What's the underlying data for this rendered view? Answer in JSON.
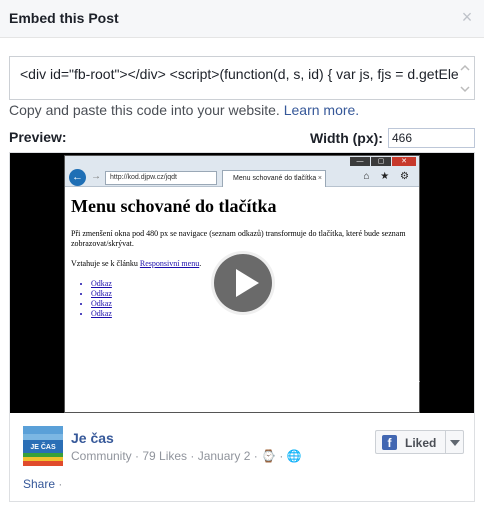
{
  "dialog": {
    "title": "Embed this Post",
    "close_glyph": "×"
  },
  "embed_code": {
    "value": "<div id=\"fb-root\"></div> <script>(function(d, s, id) { var js, fjs = d.getEle"
  },
  "help": {
    "text": "Copy and paste this code into your website.",
    "link": "Learn more."
  },
  "preview": {
    "label": "Preview:",
    "width_label": "Width (px):",
    "width_value": "466"
  },
  "video": {
    "browser": {
      "address": "http://kod.djpw.cz/jqdt",
      "tab_title": "Menu schované do tlačítka",
      "tab_close": "×",
      "tools": "⌂ ★ ⚙"
    },
    "page": {
      "heading": "Menu schované do tlačítka",
      "para1": "Při zmenšení okna pod 480 px se navigace (seznam odkazů) transformuje do tlačítka, které bude seznam zobrazovat/skrývat.",
      "para2_prefix": "Vztahuje se k článku",
      "para2_link": "Responsivní menu",
      "list": [
        "Odkaz",
        "Odkaz",
        "Odkaz",
        "Odkaz"
      ]
    },
    "resize_glyph": "⇔"
  },
  "post": {
    "page_name": "Je čas",
    "meta": "Community · 79 Likes · January 2 · ⌚ · 🌐",
    "avatar_text": "JE ČAS",
    "like_label": "Liked",
    "like_icon": "f",
    "share_label": "Share",
    "share_sep": " ·"
  },
  "colors": {
    "link": "#365899",
    "header_bg": "#f6f7f9",
    "like_icon": "#4267b2"
  }
}
